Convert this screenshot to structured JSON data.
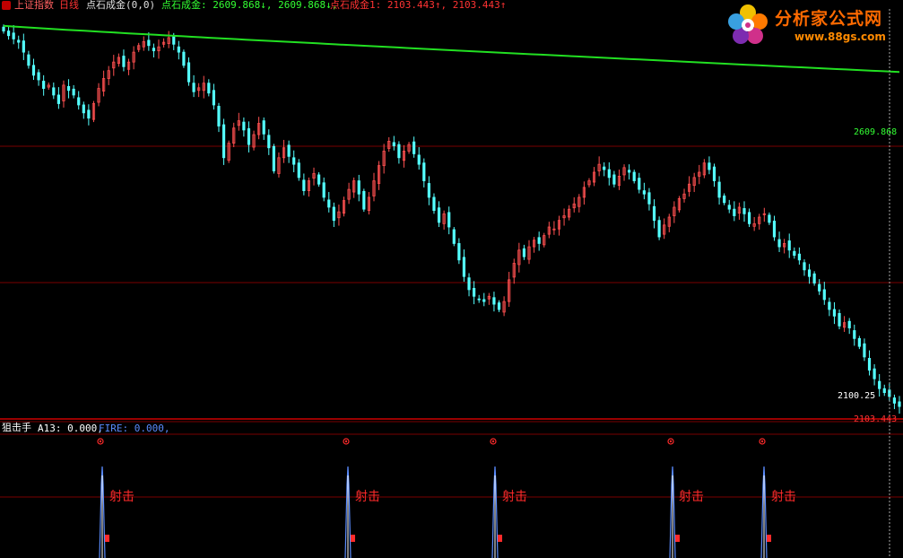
{
  "main": {
    "instrument": "上证指数",
    "period": "日线",
    "indicator_name": "点石成金(0,0)",
    "series": [
      {
        "name": "点石成金",
        "text": "点石成金: 2609.868↓, 2609.868↓,",
        "color": "#33ff33"
      },
      {
        "name": "点石成金1",
        "text": "点石成金1: 2103.443↑, 2103.443↑",
        "color": "#ff3333"
      }
    ],
    "ma_label": "2609.868",
    "low_label": "2100.25",
    "bottom_label": "2103.443"
  },
  "sub": {
    "title": "狙击手",
    "a13": "A13: 0.000,",
    "fire": "FIRE: 0.000,",
    "signal_text": "射击"
  },
  "logo": {
    "brand": "分析家公式网",
    "url": "www.88gs.com"
  },
  "colors": {
    "up": "#ff5050",
    "down": "#54ffff",
    "ma": "#22e022",
    "grid": "#7a0000",
    "signal": "#ff2a2a",
    "spike": "#5a8cff"
  },
  "chart_data": {
    "type": "candlestick",
    "ma_trend_start": 2680,
    "ma_trend_end": 2609.868,
    "closes": [
      2672,
      2665,
      2660,
      2655,
      2640,
      2620,
      2605,
      2598,
      2585,
      2590,
      2575,
      2562,
      2590,
      2582,
      2575,
      2560,
      2548,
      2540,
      2562,
      2585,
      2600,
      2612,
      2625,
      2632,
      2618,
      2625,
      2640,
      2650,
      2656,
      2650,
      2642,
      2648,
      2655,
      2662,
      2652,
      2640,
      2620,
      2595,
      2580,
      2586,
      2593,
      2578,
      2560,
      2528,
      2480,
      2502,
      2525,
      2536,
      2522,
      2500,
      2515,
      2532,
      2516,
      2495,
      2460,
      2480,
      2495,
      2482,
      2470,
      2450,
      2430,
      2445,
      2456,
      2440,
      2420,
      2405,
      2385,
      2398,
      2415,
      2432,
      2445,
      2425,
      2402,
      2420,
      2445,
      2468,
      2490,
      2505,
      2498,
      2480,
      2490,
      2500,
      2486,
      2470,
      2445,
      2420,
      2400,
      2382,
      2395,
      2375,
      2350,
      2325,
      2300,
      2280,
      2270,
      2265,
      2262,
      2270,
      2258,
      2250,
      2262,
      2295,
      2320,
      2340,
      2330,
      2345,
      2355,
      2350,
      2362,
      2375,
      2372,
      2385,
      2392,
      2402,
      2410,
      2420,
      2435,
      2445,
      2458,
      2470,
      2462,
      2450,
      2440,
      2452,
      2465,
      2458,
      2445,
      2432,
      2425,
      2410,
      2385,
      2360,
      2378,
      2390,
      2405,
      2418,
      2425,
      2440,
      2450,
      2458,
      2472,
      2462,
      2445,
      2420,
      2412,
      2402,
      2392,
      2405,
      2395,
      2380,
      2380,
      2390,
      2395,
      2382,
      2360,
      2345,
      2350,
      2340,
      2332,
      2325,
      2310,
      2300,
      2290,
      2278,
      2265,
      2250,
      2240,
      2225,
      2230,
      2222,
      2206,
      2194,
      2178,
      2158,
      2145,
      2130,
      2124,
      2118,
      2108,
      2103
    ]
  }
}
